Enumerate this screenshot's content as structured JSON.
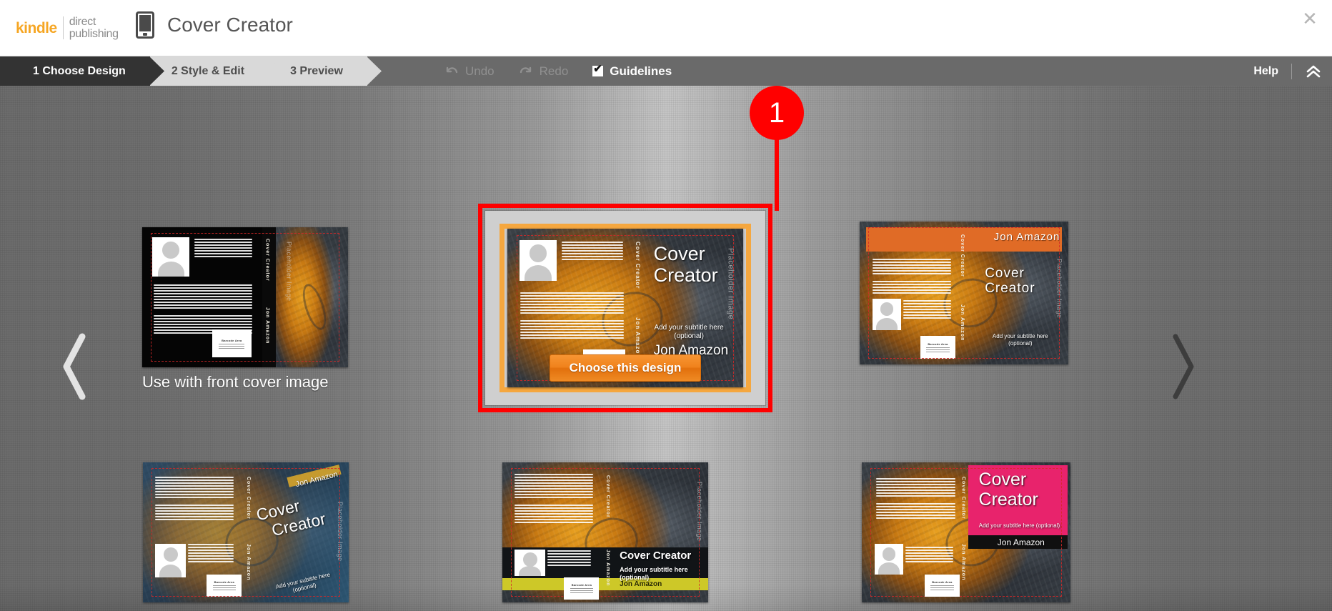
{
  "header": {
    "brand_kindle": "kindle",
    "brand_line1": "direct",
    "brand_line2": "publishing",
    "device_icon": "tablet-icon",
    "app_title": "Cover Creator",
    "close_icon": "close-icon"
  },
  "toolbar": {
    "steps": [
      {
        "label": "1 Choose Design",
        "active": true
      },
      {
        "label": "2 Style & Edit",
        "active": false
      },
      {
        "label": "3 Preview",
        "active": false
      }
    ],
    "undo_label": "Undo",
    "undo_icon": "undo-arrow-icon",
    "undo_enabled": false,
    "redo_label": "Redo",
    "redo_icon": "redo-arrow-icon",
    "redo_enabled": false,
    "guidelines_label": "Guidelines",
    "guidelines_checked": true,
    "help_label": "Help",
    "collapse_icon": "double-chevron-up-icon"
  },
  "carousel": {
    "prev_icon": "chevron-left-icon",
    "next_icon": "chevron-right-icon",
    "choose_button_label": "Choose this design",
    "selected_index": 1
  },
  "cover_text": {
    "title_line1": "Cover",
    "title_line2": "Creator",
    "title_full": "Cover Creator",
    "author": "Jon Amazon",
    "subtitle": "Add your subtitle here (optional)",
    "placeholder_image": "Placeholder Image",
    "spine_title": "Cover Creator",
    "spine_author": "Jon Amazon",
    "barcode_title": "Barcode Area",
    "barcode_note1": "This area is reserved for use",
    "barcode_note2": "by the printer's barcode"
  },
  "designs": [
    {
      "id": "design-1",
      "caption": "Use with front cover image",
      "style": "dark-black"
    },
    {
      "id": "design-2",
      "caption": "",
      "style": "grunge-plain"
    },
    {
      "id": "design-3",
      "caption": "",
      "style": "orange-banner"
    },
    {
      "id": "design-4",
      "caption": "",
      "style": "blue-angled"
    },
    {
      "id": "design-5",
      "caption": "",
      "style": "dark-band-olive"
    },
    {
      "id": "design-6",
      "caption": "",
      "style": "pink-block"
    }
  ],
  "annotation": {
    "badge_number": "1",
    "color": "#ff0000"
  },
  "colors": {
    "brand_orange": "#f6a623",
    "button_orange": "#ef8a24",
    "selection_orange": "#f5a73f",
    "active_step_bg": "#333333",
    "toolbar_bg": "#6a6a6a",
    "annotation_red": "#ff0000"
  }
}
